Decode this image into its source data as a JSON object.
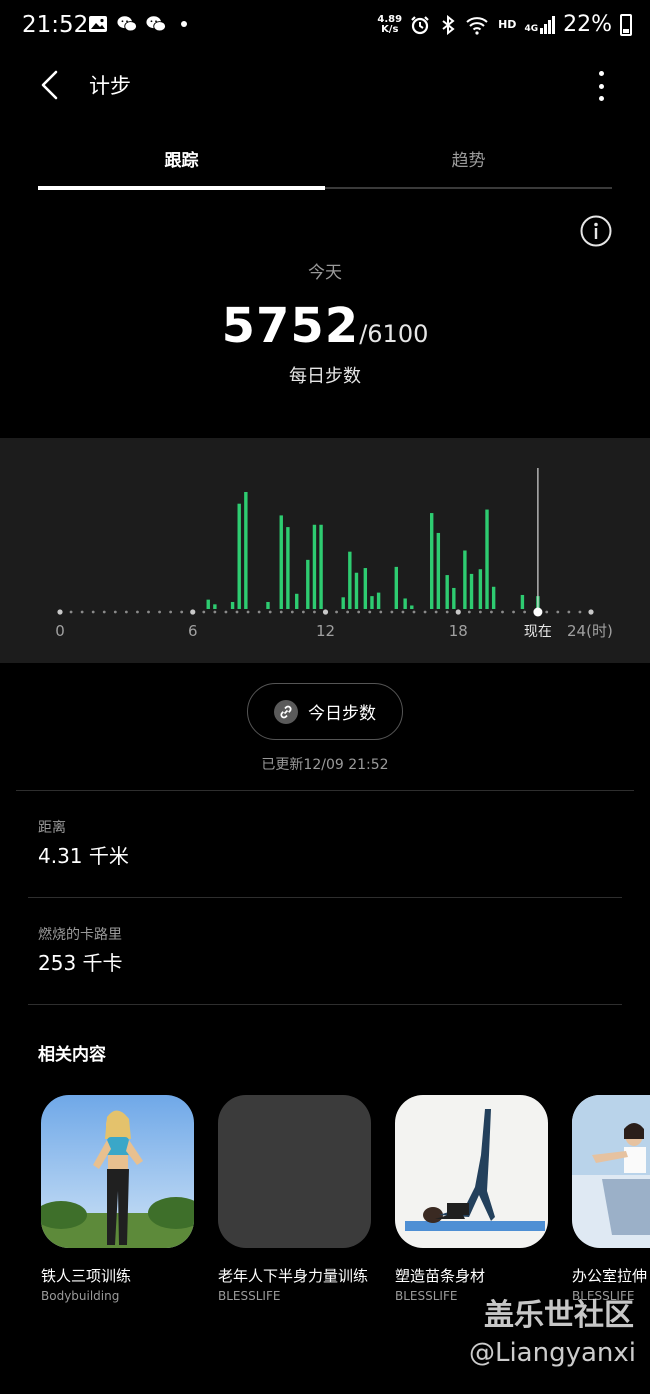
{
  "status_bar": {
    "time": "21:52",
    "net_speed_value": "4.89",
    "net_speed_unit": "K/s",
    "hd_label": "HD",
    "cell_label": "4G",
    "battery": "22%"
  },
  "header": {
    "title": "计步"
  },
  "tabs": [
    {
      "label": "跟踪",
      "active": true
    },
    {
      "label": "趋势",
      "active": false
    }
  ],
  "summary": {
    "period": "今天",
    "steps": "5752",
    "goal": "/6100",
    "caption": "每日步数"
  },
  "chart_data": {
    "type": "bar",
    "x_ticks": [
      "0",
      "6",
      "12",
      "18",
      "现在",
      "24(时)"
    ],
    "x_range": [
      0,
      24
    ],
    "now_hour": 21.6,
    "bar_color": "#2ecc71",
    "bars": [
      {
        "x": 6.7,
        "v": 0.08
      },
      {
        "x": 7.0,
        "v": 0.04
      },
      {
        "x": 7.8,
        "v": 0.06
      },
      {
        "x": 8.1,
        "v": 0.9
      },
      {
        "x": 8.4,
        "v": 1.0
      },
      {
        "x": 9.4,
        "v": 0.06
      },
      {
        "x": 10.0,
        "v": 0.8
      },
      {
        "x": 10.3,
        "v": 0.7
      },
      {
        "x": 10.7,
        "v": 0.13
      },
      {
        "x": 11.2,
        "v": 0.42
      },
      {
        "x": 11.5,
        "v": 0.72
      },
      {
        "x": 11.8,
        "v": 0.72
      },
      {
        "x": 12.8,
        "v": 0.1
      },
      {
        "x": 13.1,
        "v": 0.49
      },
      {
        "x": 13.4,
        "v": 0.31
      },
      {
        "x": 13.8,
        "v": 0.35
      },
      {
        "x": 14.1,
        "v": 0.11
      },
      {
        "x": 14.4,
        "v": 0.14
      },
      {
        "x": 15.2,
        "v": 0.36
      },
      {
        "x": 15.6,
        "v": 0.09
      },
      {
        "x": 15.9,
        "v": 0.03
      },
      {
        "x": 16.8,
        "v": 0.82
      },
      {
        "x": 17.1,
        "v": 0.65
      },
      {
        "x": 17.5,
        "v": 0.29
      },
      {
        "x": 17.8,
        "v": 0.18
      },
      {
        "x": 18.3,
        "v": 0.5
      },
      {
        "x": 18.6,
        "v": 0.3
      },
      {
        "x": 19.0,
        "v": 0.34
      },
      {
        "x": 19.3,
        "v": 0.85
      },
      {
        "x": 19.6,
        "v": 0.19
      },
      {
        "x": 20.9,
        "v": 0.12
      },
      {
        "x": 21.6,
        "v": 0.11
      }
    ]
  },
  "link_button": {
    "label": "今日步数"
  },
  "updated": "已更新12/09 21:52",
  "stats": [
    {
      "label": "距离",
      "value": "4.31 千米"
    },
    {
      "label": "燃烧的卡路里",
      "value": "253 千卡"
    }
  ],
  "related": {
    "title": "相关内容",
    "items": [
      {
        "title": "铁人三项训练",
        "source": "Bodybuilding"
      },
      {
        "title": "老年人下半身力量训练",
        "source": "BLESSLIFE"
      },
      {
        "title": "塑造苗条身材",
        "source": "BLESSLIFE"
      },
      {
        "title": "办公室拉伸",
        "source": "BLESSLIFE"
      }
    ]
  },
  "watermark": {
    "line1": "盖乐世社区",
    "line2": "@Liangyanxi"
  }
}
